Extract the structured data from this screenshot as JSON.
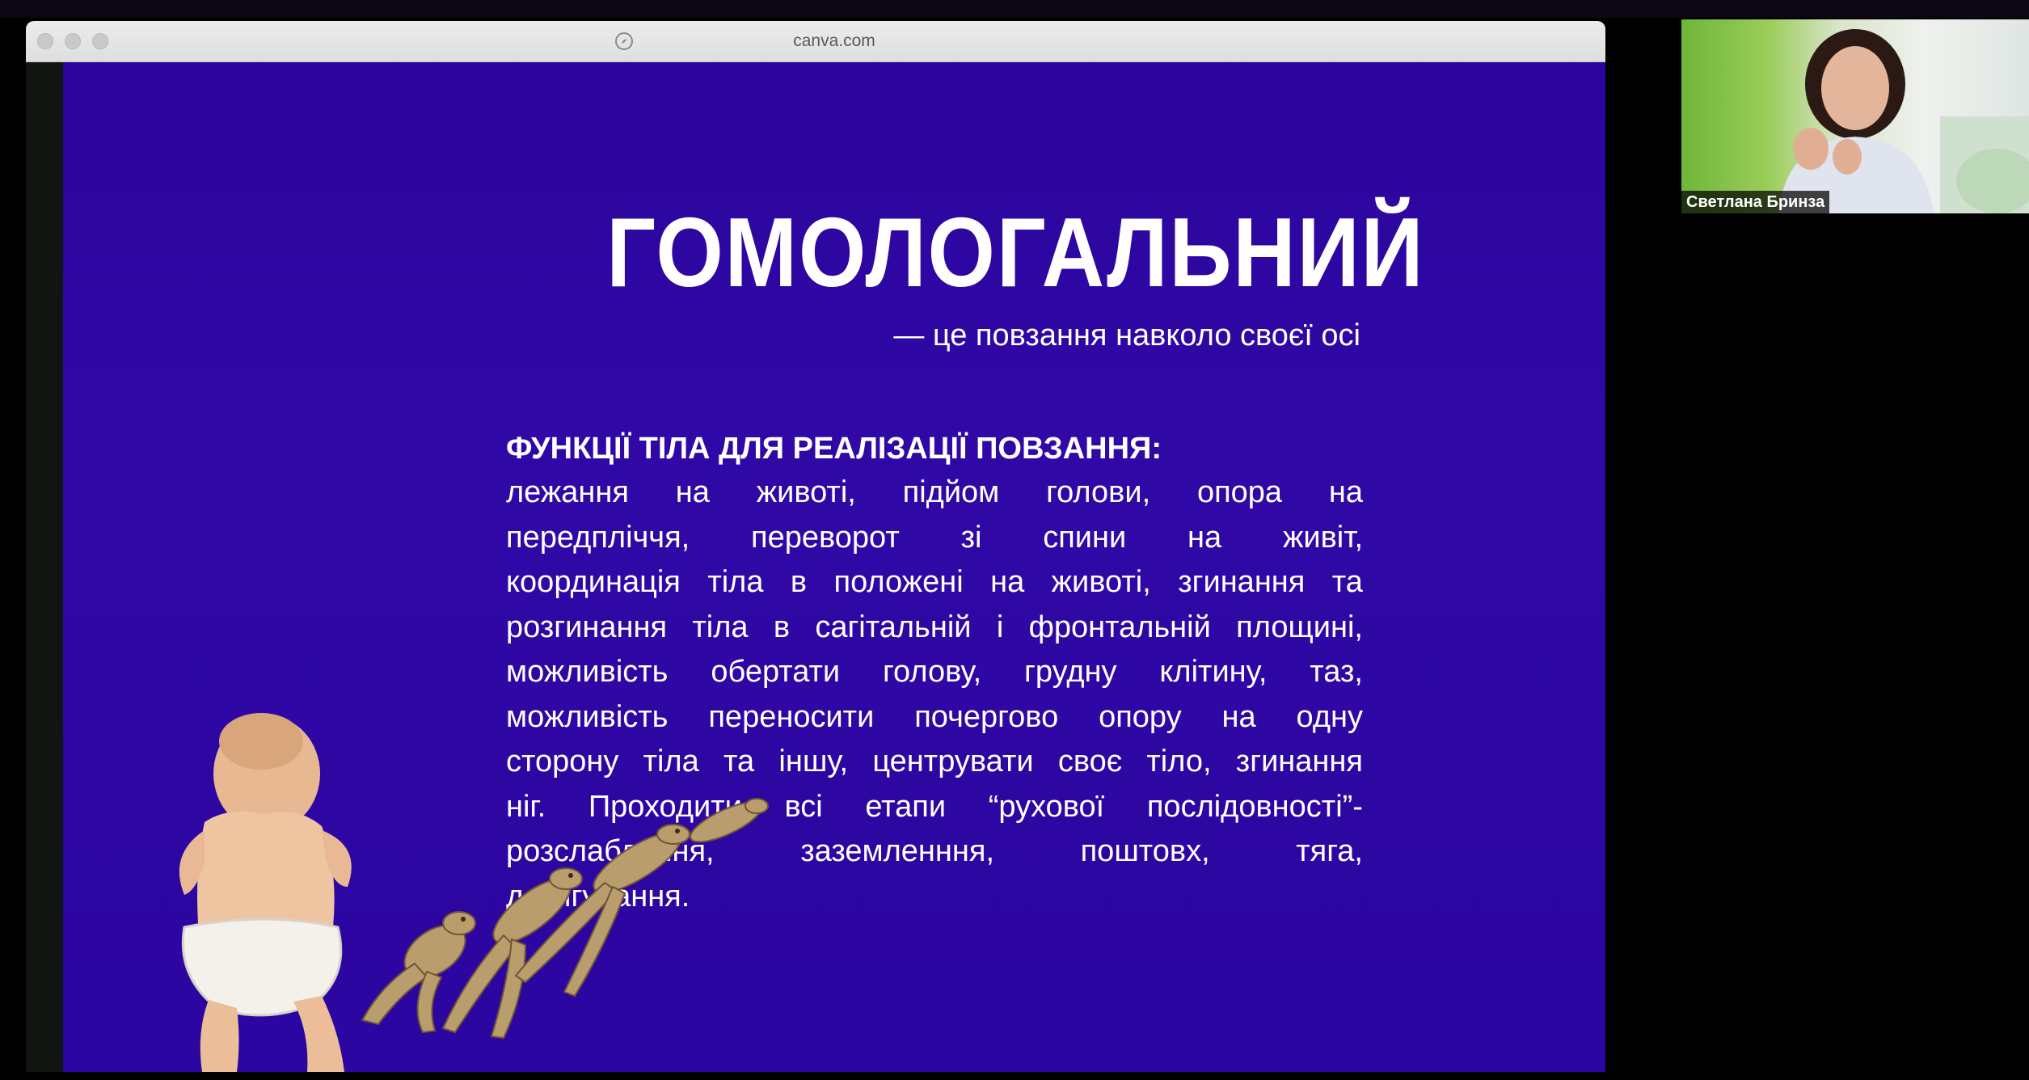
{
  "browser": {
    "url": "canva.com"
  },
  "slide": {
    "title": "ГОМОЛОГАЛЬНИЙ",
    "subtitle": "— це повзання навколо своєї осі",
    "heading": "ФУНКЦІЇ ТІЛА ДЛЯ РЕАЛІЗАЦІЇ ПОВЗАННЯ:",
    "body_lines": [
      [
        "лежання",
        "на",
        "животі,",
        "підйом",
        "голови,",
        "опора",
        "на"
      ],
      [
        "передпліччя,",
        "переворот",
        "зі",
        "спини",
        "на",
        "живіт,"
      ],
      [
        "координація",
        "тіла",
        "в",
        "положені",
        "на",
        "животі,",
        "згинання",
        "та"
      ],
      [
        "розгинання",
        "тіла",
        "в",
        "сагітальній",
        "і",
        "фронтальній",
        "площині,"
      ],
      [
        "можливість",
        "обертати",
        "голову,",
        "грудну",
        "клітину,",
        "таз,"
      ],
      [
        "можливість",
        "переносити",
        "почергово",
        "опору",
        "на",
        "одну"
      ],
      [
        "сторону",
        "тіла",
        "та",
        "іншу,",
        "центрувати",
        "своє",
        "тіло,",
        "згинання"
      ],
      [
        "ніг.",
        "Проходити",
        "всі",
        "етапи",
        "“рухової",
        "послідовності”-"
      ],
      [
        "розслаблення,",
        "заземленння,",
        "поштовх,",
        "тяга,"
      ],
      [
        "дотягування."
      ]
    ]
  },
  "webcam": {
    "participant_name": "Светлана Бринза"
  },
  "colors": {
    "slide_background": "#2e07a2",
    "text": "#ffffff"
  },
  "icons": {
    "address_bar": "compass-icon"
  }
}
